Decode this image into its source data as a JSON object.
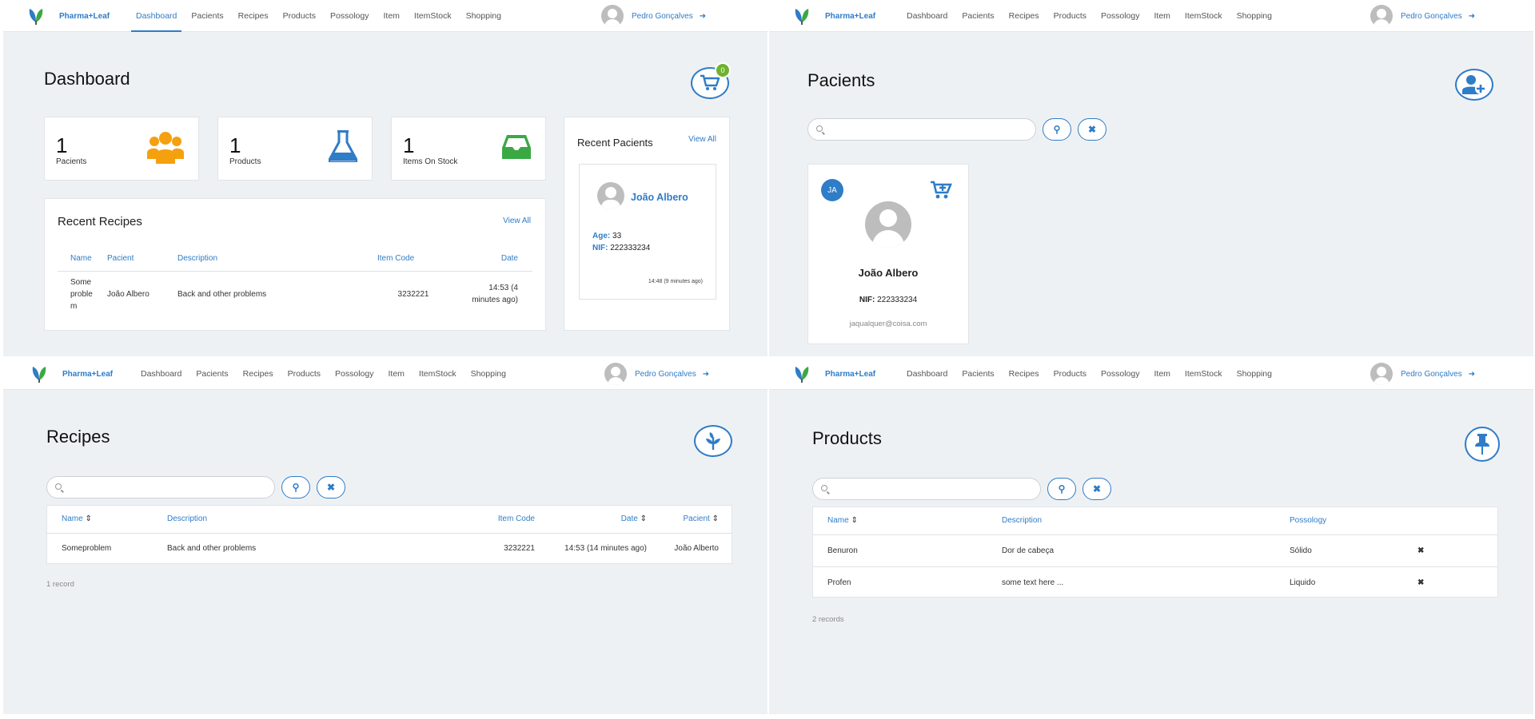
{
  "brand": {
    "name": "Pharma+Leaf"
  },
  "nav": [
    "Dashboard",
    "Pacients",
    "Recipes",
    "Products",
    "Possology",
    "Item",
    "ItemStock",
    "Shopping"
  ],
  "user": {
    "name": "Pedro Gonçalves"
  },
  "colors": {
    "primary": "#2f7cc7",
    "badge": "#6fb22f",
    "pacients_icon": "#f5a00f",
    "products_icon": "#2f7cc7",
    "stock_icon": "#3aa944",
    "delete": "#c0392b"
  },
  "dashboard": {
    "title": "Dashboard",
    "cart_count": "0",
    "stats": [
      {
        "value": "1",
        "label": "Pacients",
        "icon": "users-icon"
      },
      {
        "value": "1",
        "label": "Products",
        "icon": "flask-icon"
      },
      {
        "value": "1",
        "label": "Items On Stock",
        "icon": "inbox-icon"
      }
    ],
    "recent_recipes": {
      "title": "Recent Recipes",
      "view_all": "View All",
      "columns": [
        "Name",
        "Pacient",
        "Description",
        "Item Code",
        "Date"
      ],
      "rows": [
        {
          "name": "Some proble m",
          "pacient": "João Albero",
          "description": "Back and other problems",
          "item_code": "3232221",
          "date": "14:53 (4 minutes ago)"
        }
      ]
    },
    "recent_pacients": {
      "title": "Recent Pacients",
      "view_all": "View All",
      "card": {
        "name": "João Albero",
        "age_label": "Age:",
        "age": "33",
        "nif_label": "NIF:",
        "nif": "222333234",
        "time": "14:48 (9 minutes ago)"
      }
    }
  },
  "pacients": {
    "title": "Pacients",
    "card": {
      "initials": "JA",
      "name": "João Albero",
      "nif_label": "NIF:",
      "nif": "222333234",
      "email": "jaqualquer@coisa.com"
    }
  },
  "recipes": {
    "title": "Recipes",
    "columns": [
      "Name",
      "Description",
      "Item Code",
      "Date",
      "Pacient"
    ],
    "rows": [
      {
        "name": "Someproblem",
        "description": "Back and other problems",
        "item_code": "3232221",
        "date": "14:53 (14 minutes ago)",
        "pacient": "João Alberto"
      }
    ],
    "records": "1 record"
  },
  "products": {
    "title": "Products",
    "columns": [
      "Name",
      "Description",
      "Possology"
    ],
    "rows": [
      {
        "name": "Benuron",
        "description": "Dor de cabeça",
        "possology": "Sólido"
      },
      {
        "name": "Profen",
        "description": "some text here ...",
        "possology": "Liquido"
      }
    ],
    "records": "2 records"
  }
}
